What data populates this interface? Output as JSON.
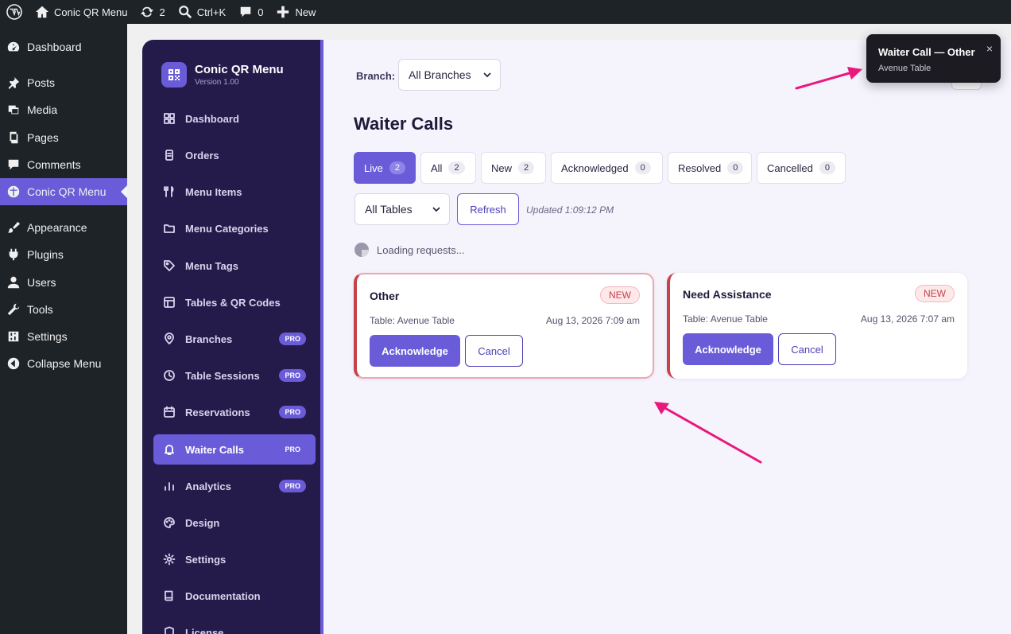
{
  "adminbar": {
    "site_name": "Conic QR Menu",
    "updates_count": "2",
    "search_shortcut": "Ctrl+K",
    "comments_count": "0",
    "new_label": "New"
  },
  "wp_menu": {
    "items": [
      {
        "label": "Dashboard",
        "icon": "dashboard-icon"
      },
      {
        "label": "Posts",
        "icon": "pin-icon"
      },
      {
        "label": "Media",
        "icon": "media-icon"
      },
      {
        "label": "Pages",
        "icon": "pages-icon"
      },
      {
        "label": "Comments",
        "icon": "comment-icon"
      },
      {
        "label": "Conic QR Menu",
        "icon": "conic-icon"
      },
      {
        "label": "Appearance",
        "icon": "brush-icon"
      },
      {
        "label": "Plugins",
        "icon": "plug-icon"
      },
      {
        "label": "Users",
        "icon": "user-icon"
      },
      {
        "label": "Tools",
        "icon": "wrench-icon"
      },
      {
        "label": "Settings",
        "icon": "sliders-icon"
      },
      {
        "label": "Collapse Menu",
        "icon": "collapse-icon"
      }
    ]
  },
  "plugin": {
    "name": "Conic QR Menu",
    "version": "Version 1.00",
    "nav": [
      {
        "label": "Dashboard",
        "icon": "grid-icon",
        "pro": ""
      },
      {
        "label": "Orders",
        "icon": "clipboard-icon",
        "pro": ""
      },
      {
        "label": "Menu Items",
        "icon": "utensils-icon",
        "pro": ""
      },
      {
        "label": "Menu Categories",
        "icon": "folder-icon",
        "pro": ""
      },
      {
        "label": "Menu Tags",
        "icon": "tag-icon",
        "pro": ""
      },
      {
        "label": "Tables & QR Codes",
        "icon": "table-icon",
        "pro": ""
      },
      {
        "label": "Branches",
        "icon": "location-pin-icon",
        "pro": "PRO"
      },
      {
        "label": "Table Sessions",
        "icon": "clock-icon",
        "pro": "PRO"
      },
      {
        "label": "Reservations",
        "icon": "calendar-icon",
        "pro": "PRO"
      },
      {
        "label": "Waiter Calls",
        "icon": "bell-icon",
        "pro": "PRO"
      },
      {
        "label": "Analytics",
        "icon": "bar-chart-icon",
        "pro": "PRO"
      },
      {
        "label": "Design",
        "icon": "palette-icon",
        "pro": ""
      },
      {
        "label": "Settings",
        "icon": "gear-icon",
        "pro": ""
      },
      {
        "label": "Documentation",
        "icon": "book-icon",
        "pro": ""
      },
      {
        "label": "License",
        "icon": "shield-icon",
        "pro": ""
      }
    ]
  },
  "main": {
    "branch_label": "Branch:",
    "branch_value": "All Branches",
    "title": "Waiter Calls",
    "tabs": [
      {
        "label": "Live",
        "count": "2"
      },
      {
        "label": "All",
        "count": "2"
      },
      {
        "label": "New",
        "count": "2"
      },
      {
        "label": "Acknowledged",
        "count": "0"
      },
      {
        "label": "Resolved",
        "count": "0"
      },
      {
        "label": "Cancelled",
        "count": "0"
      }
    ],
    "table_filter": "All Tables",
    "refresh_label": "Refresh",
    "updated_text": "Updated 1:09:12 PM",
    "loading_text": "Loading requests...",
    "cards": [
      {
        "title": "Other",
        "badge": "NEW",
        "table": "Table: Avenue Table",
        "time": "Aug 13, 2026 7:09 am",
        "ack": "Acknowledge",
        "cancel": "Cancel"
      },
      {
        "title": "Need Assistance",
        "badge": "NEW",
        "table": "Table: Avenue Table",
        "time": "Aug 13, 2026 7:07 am",
        "ack": "Acknowledge",
        "cancel": "Cancel"
      }
    ]
  },
  "toast": {
    "title": "Waiter Call — Other",
    "subtitle": "Avenue Table",
    "close": "×"
  },
  "colors": {
    "accent": "#6a5cd8",
    "sidebar": "#241b4a",
    "new_badge": "#c6424a",
    "annotation_arrow": "#e8187c"
  }
}
